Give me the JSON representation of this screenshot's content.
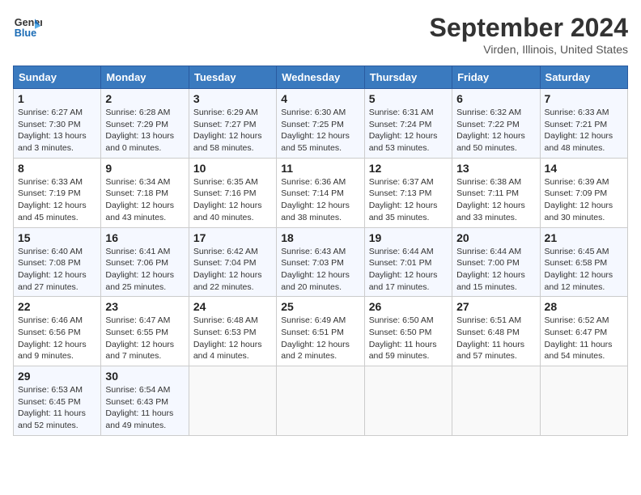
{
  "header": {
    "logo_line1": "General",
    "logo_line2": "Blue",
    "month": "September 2024",
    "location": "Virden, Illinois, United States"
  },
  "columns": [
    "Sunday",
    "Monday",
    "Tuesday",
    "Wednesday",
    "Thursday",
    "Friday",
    "Saturday"
  ],
  "weeks": [
    [
      {
        "day": "1",
        "sunrise": "Sunrise: 6:27 AM",
        "sunset": "Sunset: 7:30 PM",
        "daylight": "Daylight: 13 hours and 3 minutes."
      },
      {
        "day": "2",
        "sunrise": "Sunrise: 6:28 AM",
        "sunset": "Sunset: 7:29 PM",
        "daylight": "Daylight: 13 hours and 0 minutes."
      },
      {
        "day": "3",
        "sunrise": "Sunrise: 6:29 AM",
        "sunset": "Sunset: 7:27 PM",
        "daylight": "Daylight: 12 hours and 58 minutes."
      },
      {
        "day": "4",
        "sunrise": "Sunrise: 6:30 AM",
        "sunset": "Sunset: 7:25 PM",
        "daylight": "Daylight: 12 hours and 55 minutes."
      },
      {
        "day": "5",
        "sunrise": "Sunrise: 6:31 AM",
        "sunset": "Sunset: 7:24 PM",
        "daylight": "Daylight: 12 hours and 53 minutes."
      },
      {
        "day": "6",
        "sunrise": "Sunrise: 6:32 AM",
        "sunset": "Sunset: 7:22 PM",
        "daylight": "Daylight: 12 hours and 50 minutes."
      },
      {
        "day": "7",
        "sunrise": "Sunrise: 6:33 AM",
        "sunset": "Sunset: 7:21 PM",
        "daylight": "Daylight: 12 hours and 48 minutes."
      }
    ],
    [
      {
        "day": "8",
        "sunrise": "Sunrise: 6:33 AM",
        "sunset": "Sunset: 7:19 PM",
        "daylight": "Daylight: 12 hours and 45 minutes."
      },
      {
        "day": "9",
        "sunrise": "Sunrise: 6:34 AM",
        "sunset": "Sunset: 7:18 PM",
        "daylight": "Daylight: 12 hours and 43 minutes."
      },
      {
        "day": "10",
        "sunrise": "Sunrise: 6:35 AM",
        "sunset": "Sunset: 7:16 PM",
        "daylight": "Daylight: 12 hours and 40 minutes."
      },
      {
        "day": "11",
        "sunrise": "Sunrise: 6:36 AM",
        "sunset": "Sunset: 7:14 PM",
        "daylight": "Daylight: 12 hours and 38 minutes."
      },
      {
        "day": "12",
        "sunrise": "Sunrise: 6:37 AM",
        "sunset": "Sunset: 7:13 PM",
        "daylight": "Daylight: 12 hours and 35 minutes."
      },
      {
        "day": "13",
        "sunrise": "Sunrise: 6:38 AM",
        "sunset": "Sunset: 7:11 PM",
        "daylight": "Daylight: 12 hours and 33 minutes."
      },
      {
        "day": "14",
        "sunrise": "Sunrise: 6:39 AM",
        "sunset": "Sunset: 7:09 PM",
        "daylight": "Daylight: 12 hours and 30 minutes."
      }
    ],
    [
      {
        "day": "15",
        "sunrise": "Sunrise: 6:40 AM",
        "sunset": "Sunset: 7:08 PM",
        "daylight": "Daylight: 12 hours and 27 minutes."
      },
      {
        "day": "16",
        "sunrise": "Sunrise: 6:41 AM",
        "sunset": "Sunset: 7:06 PM",
        "daylight": "Daylight: 12 hours and 25 minutes."
      },
      {
        "day": "17",
        "sunrise": "Sunrise: 6:42 AM",
        "sunset": "Sunset: 7:04 PM",
        "daylight": "Daylight: 12 hours and 22 minutes."
      },
      {
        "day": "18",
        "sunrise": "Sunrise: 6:43 AM",
        "sunset": "Sunset: 7:03 PM",
        "daylight": "Daylight: 12 hours and 20 minutes."
      },
      {
        "day": "19",
        "sunrise": "Sunrise: 6:44 AM",
        "sunset": "Sunset: 7:01 PM",
        "daylight": "Daylight: 12 hours and 17 minutes."
      },
      {
        "day": "20",
        "sunrise": "Sunrise: 6:44 AM",
        "sunset": "Sunset: 7:00 PM",
        "daylight": "Daylight: 12 hours and 15 minutes."
      },
      {
        "day": "21",
        "sunrise": "Sunrise: 6:45 AM",
        "sunset": "Sunset: 6:58 PM",
        "daylight": "Daylight: 12 hours and 12 minutes."
      }
    ],
    [
      {
        "day": "22",
        "sunrise": "Sunrise: 6:46 AM",
        "sunset": "Sunset: 6:56 PM",
        "daylight": "Daylight: 12 hours and 9 minutes."
      },
      {
        "day": "23",
        "sunrise": "Sunrise: 6:47 AM",
        "sunset": "Sunset: 6:55 PM",
        "daylight": "Daylight: 12 hours and 7 minutes."
      },
      {
        "day": "24",
        "sunrise": "Sunrise: 6:48 AM",
        "sunset": "Sunset: 6:53 PM",
        "daylight": "Daylight: 12 hours and 4 minutes."
      },
      {
        "day": "25",
        "sunrise": "Sunrise: 6:49 AM",
        "sunset": "Sunset: 6:51 PM",
        "daylight": "Daylight: 12 hours and 2 minutes."
      },
      {
        "day": "26",
        "sunrise": "Sunrise: 6:50 AM",
        "sunset": "Sunset: 6:50 PM",
        "daylight": "Daylight: 11 hours and 59 minutes."
      },
      {
        "day": "27",
        "sunrise": "Sunrise: 6:51 AM",
        "sunset": "Sunset: 6:48 PM",
        "daylight": "Daylight: 11 hours and 57 minutes."
      },
      {
        "day": "28",
        "sunrise": "Sunrise: 6:52 AM",
        "sunset": "Sunset: 6:47 PM",
        "daylight": "Daylight: 11 hours and 54 minutes."
      }
    ],
    [
      {
        "day": "29",
        "sunrise": "Sunrise: 6:53 AM",
        "sunset": "Sunset: 6:45 PM",
        "daylight": "Daylight: 11 hours and 52 minutes."
      },
      {
        "day": "30",
        "sunrise": "Sunrise: 6:54 AM",
        "sunset": "Sunset: 6:43 PM",
        "daylight": "Daylight: 11 hours and 49 minutes."
      },
      null,
      null,
      null,
      null,
      null
    ]
  ]
}
